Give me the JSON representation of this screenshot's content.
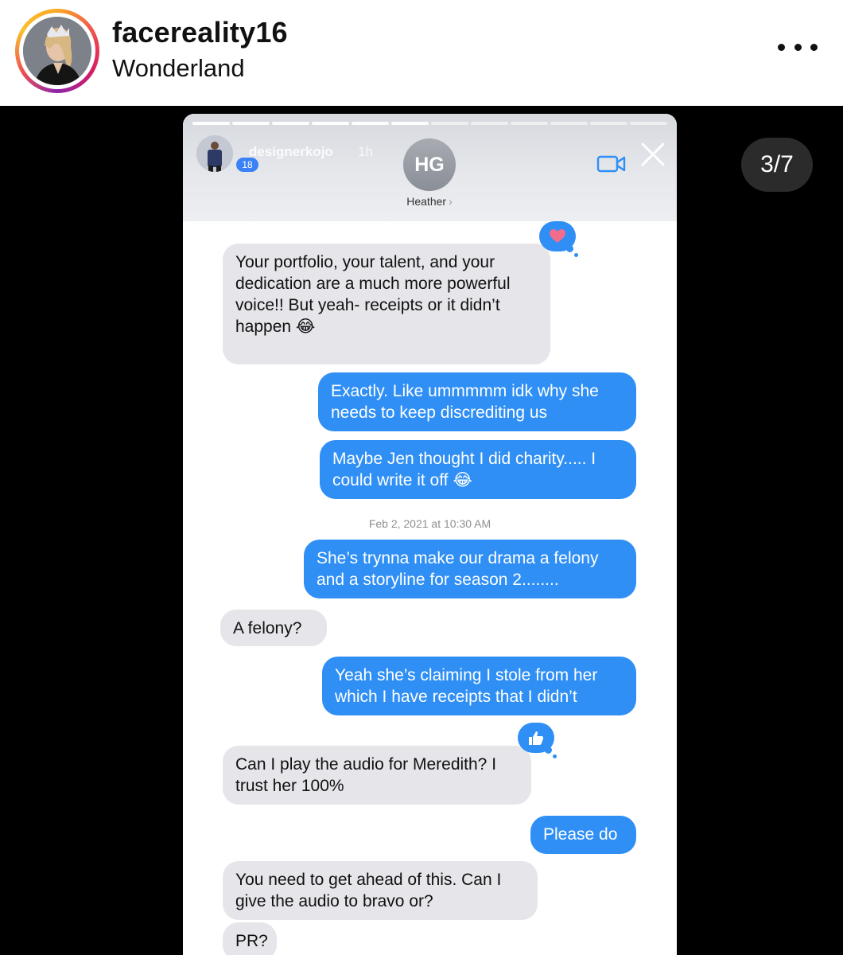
{
  "post": {
    "username": "facereality16",
    "location": "Wonderland",
    "counter": "3/7"
  },
  "story": {
    "poster_name": "designerkojo",
    "poster_time": "1h",
    "poster_badge": "18",
    "contact_initials": "HG",
    "contact_name": "Heather",
    "contact_chevron": "›",
    "progress_total": 12,
    "progress_done": 6,
    "icons": {
      "video": "video-camera-icon",
      "close": "close-icon",
      "heart_reaction": "heart-icon",
      "thumbs_reaction": "thumbs-up-icon",
      "more": "more-options-icon"
    },
    "colors": {
      "sent_bubble": "#2f8ff5",
      "received_bubble": "#e5e5ea",
      "timestamp": "#8e8e93"
    }
  },
  "messages": [
    {
      "side": "in",
      "lines": [
        "Your portfolio, your talent,  and your",
        "dedication are a much more powerful",
        "voice!! But yeah- receipts or it didn’t",
        "happen 😂"
      ],
      "reaction": "heart"
    },
    {
      "side": "out",
      "lines": [
        "Exactly. Like ummmmm idk why she",
        "needs to keep discrediting us"
      ]
    },
    {
      "side": "out",
      "lines": [
        "Maybe Jen thought I did charity..... I",
        "could write it off 😂"
      ]
    },
    {
      "type": "timestamp",
      "date": "Feb 2, 2021",
      "time_prefix": "at",
      "time": "10:30 AM"
    },
    {
      "side": "out",
      "lines": [
        "She’s trynna make our drama a felony",
        "and a storyline for season 2........"
      ]
    },
    {
      "side": "in",
      "lines": [
        "A felony?"
      ]
    },
    {
      "side": "out",
      "lines": [
        "Yeah she’s claiming I stole from her",
        "which I have receipts that I didn’t"
      ]
    },
    {
      "side": "in",
      "lines": [
        "Can I play the audio for Meredith? I",
        "trust her 100%"
      ],
      "reaction": "thumbs"
    },
    {
      "side": "out",
      "lines": [
        "Please do"
      ]
    },
    {
      "side": "in",
      "lines": [
        "You need to get ahead of this. Can I",
        "give the audio to bravo or?"
      ]
    },
    {
      "side": "in",
      "lines": [
        "PR?"
      ]
    }
  ]
}
